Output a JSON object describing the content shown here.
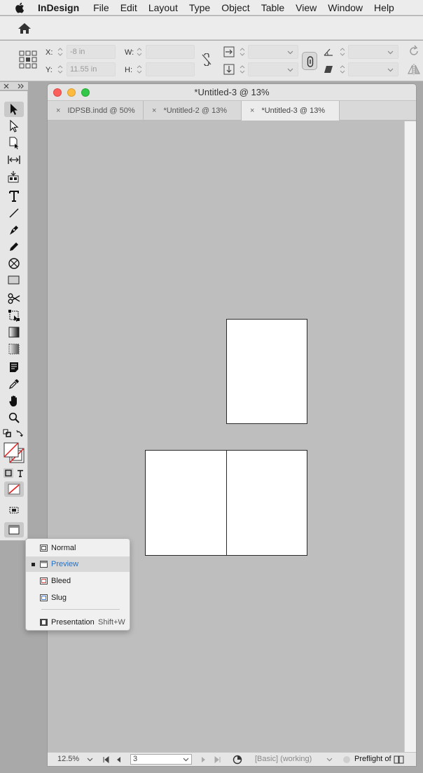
{
  "menubar": {
    "app": "InDesign",
    "items": [
      "File",
      "Edit",
      "Layout",
      "Type",
      "Object",
      "Table",
      "View",
      "Window",
      "Help"
    ]
  },
  "control": {
    "x_label": "X:",
    "x_value": "-8 in",
    "y_label": "Y:",
    "y_value": "11.55 in",
    "w_label": "W:",
    "h_label": "H:"
  },
  "document": {
    "title": "*Untitled-3 @ 13%",
    "tabs": [
      {
        "label": "IDPSB.indd @ 50%",
        "active": false
      },
      {
        "label": "*Untitled-2 @ 13%",
        "active": false
      },
      {
        "label": "*Untitled-3 @ 13%",
        "active": true
      }
    ],
    "tab_close_glyph": "×"
  },
  "status": {
    "zoom": "12.5%",
    "page": "3",
    "profile": "[Basic] (working)",
    "preflight": "Preflight of"
  },
  "screen_mode_menu": {
    "items": [
      {
        "label": "Normal",
        "shortcut": "",
        "selected": false
      },
      {
        "label": "Preview",
        "shortcut": "",
        "selected": true
      },
      {
        "label": "Bleed",
        "shortcut": "",
        "selected": false
      },
      {
        "label": "Slug",
        "shortcut": "",
        "selected": false
      },
      {
        "label": "Presentation",
        "shortcut": "Shift+W",
        "selected": false
      }
    ]
  },
  "colors": {
    "accent": "#2470c8",
    "close": "#fc605c",
    "minimize": "#fdbc40",
    "zoom": "#34c84a"
  }
}
